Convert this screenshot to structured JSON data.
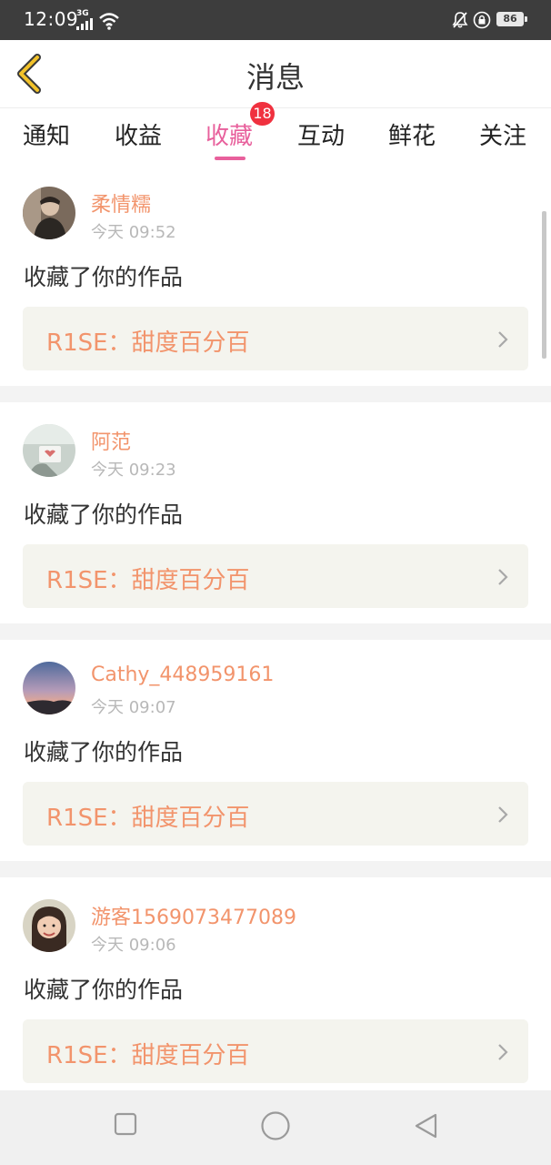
{
  "status_bar": {
    "time": "12:09",
    "network": "3G",
    "battery": "86",
    "icons": [
      "signal-icon",
      "wifi-icon",
      "bell-muted-icon",
      "lock-icon",
      "battery-icon"
    ]
  },
  "header": {
    "title": "消息",
    "back_icon": "chevron-left-icon"
  },
  "tabs": {
    "items": [
      {
        "label": "通知"
      },
      {
        "label": "收益"
      },
      {
        "label": "收藏"
      },
      {
        "label": "互动"
      },
      {
        "label": "鲜花"
      },
      {
        "label": "关注"
      }
    ],
    "active": "收藏",
    "badge": "18"
  },
  "notifications": [
    {
      "user": "柔情糯",
      "time": "今天 09:52",
      "action": "收藏了你的作品",
      "work": "R1SE：甜度百分百"
    },
    {
      "user": "阿范",
      "time": "今天 09:23",
      "action": "收藏了你的作品",
      "work": "R1SE：甜度百分百"
    },
    {
      "user": "Cathy_448959161",
      "time": "今天 09:07",
      "action": "收藏了你的作品",
      "work": "R1SE：甜度百分百"
    },
    {
      "user": "游客1569073477089",
      "time": "今天 09:06",
      "action": "收藏了你的作品",
      "work": "R1SE：甜度百分百"
    }
  ],
  "nav_bar": {
    "icons": [
      "recents-square-icon",
      "home-circle-icon",
      "back-triangle-icon"
    ]
  },
  "colors": {
    "accent_pink": "#e8609c",
    "orange_text": "#f2946c",
    "badge_red": "#f0313f",
    "back_arrow": "#f2c22a",
    "status_bar_bg": "#3d3d3d"
  }
}
